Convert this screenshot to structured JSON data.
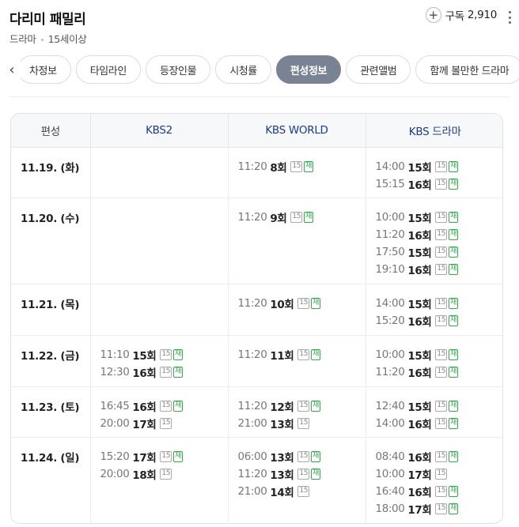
{
  "header": {
    "title": "다리미 패밀리",
    "genre": "드라마",
    "rating": "15세이상",
    "subscribe_label": "구독",
    "subscribe_count": "2,910"
  },
  "tabs": [
    {
      "label": "차정보",
      "active": false
    },
    {
      "label": "타임라인",
      "active": false
    },
    {
      "label": "등장인물",
      "active": false
    },
    {
      "label": "시청률",
      "active": false
    },
    {
      "label": "편성정보",
      "active": true
    },
    {
      "label": "관련앨범",
      "active": false
    },
    {
      "label": "함께 볼만한 드라마",
      "active": false
    }
  ],
  "schedule": {
    "head_label": "편성",
    "channels": [
      "KBS2",
      "KBS WORLD",
      "KBS 드라마"
    ],
    "rows": [
      {
        "date": "11.19. (화)",
        "slots": [
          [],
          [
            {
              "time": "11:20",
              "ep": "8회",
              "age": "15",
              "re": "재"
            }
          ],
          [
            {
              "time": "14:00",
              "ep": "15회",
              "age": "15",
              "re": "재"
            },
            {
              "time": "15:15",
              "ep": "16회",
              "age": "15",
              "re": "재"
            }
          ]
        ]
      },
      {
        "date": "11.20. (수)",
        "slots": [
          [],
          [
            {
              "time": "11:20",
              "ep": "9회",
              "age": "15",
              "re": "재"
            }
          ],
          [
            {
              "time": "10:00",
              "ep": "15회",
              "age": "15",
              "re": "재"
            },
            {
              "time": "11:20",
              "ep": "16회",
              "age": "15",
              "re": "재"
            },
            {
              "time": "17:50",
              "ep": "15회",
              "age": "15",
              "re": "재"
            },
            {
              "time": "19:10",
              "ep": "16회",
              "age": "15",
              "re": "재"
            }
          ]
        ]
      },
      {
        "date": "11.21. (목)",
        "slots": [
          [],
          [
            {
              "time": "11:20",
              "ep": "10회",
              "age": "15",
              "re": "재"
            }
          ],
          [
            {
              "time": "14:00",
              "ep": "15회",
              "age": "15",
              "re": "재"
            },
            {
              "time": "15:20",
              "ep": "16회",
              "age": "15",
              "re": "재"
            }
          ]
        ]
      },
      {
        "date": "11.22. (금)",
        "slots": [
          [
            {
              "time": "11:10",
              "ep": "15회",
              "age": "15",
              "re": "재"
            },
            {
              "time": "12:30",
              "ep": "16회",
              "age": "15",
              "re": "재"
            }
          ],
          [
            {
              "time": "11:20",
              "ep": "11회",
              "age": "15",
              "re": "재"
            }
          ],
          [
            {
              "time": "10:00",
              "ep": "15회",
              "age": "15",
              "re": "재"
            },
            {
              "time": "11:20",
              "ep": "16회",
              "age": "15",
              "re": "재"
            }
          ]
        ]
      },
      {
        "date": "11.23. (토)",
        "slots": [
          [
            {
              "time": "16:45",
              "ep": "16회",
              "age": "15",
              "re": "재"
            },
            {
              "time": "20:00",
              "ep": "17회",
              "age": "15",
              "re": ""
            }
          ],
          [
            {
              "time": "11:20",
              "ep": "12회",
              "age": "15",
              "re": "재"
            },
            {
              "time": "21:00",
              "ep": "13회",
              "age": "15",
              "re": ""
            }
          ],
          [
            {
              "time": "12:40",
              "ep": "15회",
              "age": "15",
              "re": "재"
            },
            {
              "time": "14:00",
              "ep": "16회",
              "age": "15",
              "re": "재"
            }
          ]
        ]
      },
      {
        "date": "11.24. (일)",
        "slots": [
          [
            {
              "time": "15:20",
              "ep": "17회",
              "age": "15",
              "re": "재"
            },
            {
              "time": "20:00",
              "ep": "18회",
              "age": "15",
              "re": ""
            }
          ],
          [
            {
              "time": "06:00",
              "ep": "13회",
              "age": "15",
              "re": "재"
            },
            {
              "time": "11:20",
              "ep": "13회",
              "age": "15",
              "re": "재"
            },
            {
              "time": "21:00",
              "ep": "14회",
              "age": "15",
              "re": ""
            }
          ],
          [
            {
              "time": "08:40",
              "ep": "16회",
              "age": "15",
              "re": "재"
            },
            {
              "time": "10:00",
              "ep": "17회",
              "age": "15",
              "re": ""
            },
            {
              "time": "16:40",
              "ep": "16회",
              "age": "15",
              "re": "재"
            },
            {
              "time": "18:00",
              "ep": "17회",
              "age": "15",
              "re": "재"
            }
          ]
        ]
      }
    ]
  }
}
